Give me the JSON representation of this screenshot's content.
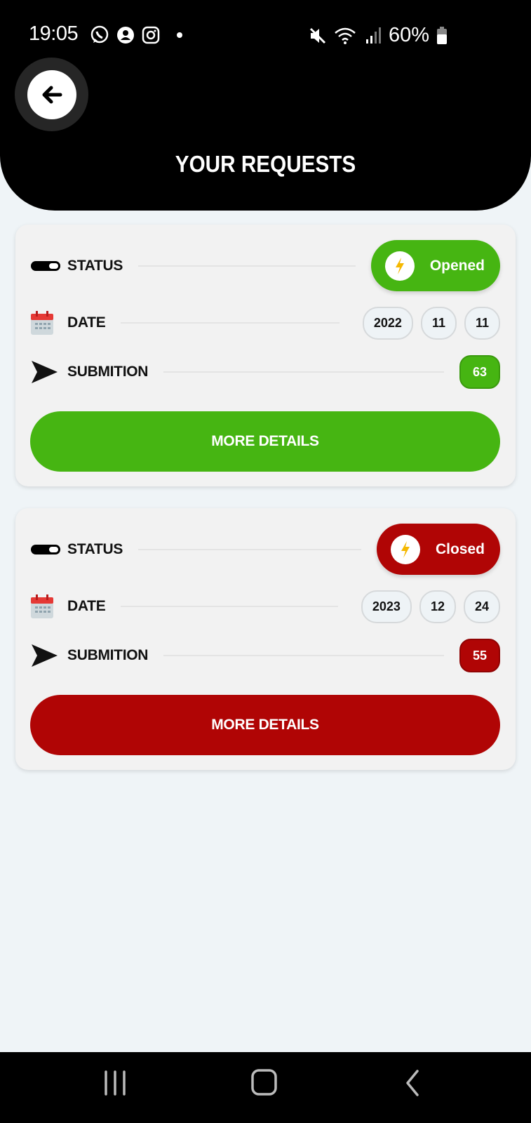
{
  "status_bar": {
    "time": "19:05",
    "battery": "60%",
    "icons": [
      "whatsapp-icon",
      "account-icon",
      "instagram-icon",
      "dot-icon",
      "mute-icon",
      "wifi-icon",
      "signal-icon",
      "battery-icon"
    ]
  },
  "header": {
    "title": "YOUR REQUESTS",
    "back_icon": "arrow-left-icon"
  },
  "labels": {
    "status": "STATUS",
    "date": "DATE",
    "submition": "SUBMITION",
    "more_details": "MORE DETAILS"
  },
  "requests": [
    {
      "status": "Opened",
      "color": "#46b512",
      "date": {
        "year": "2022",
        "month": "11",
        "day": "11"
      },
      "submition": "63"
    },
    {
      "status": "Closed",
      "color": "#b00505",
      "date": {
        "year": "2023",
        "month": "12",
        "day": "24"
      },
      "submition": "55"
    }
  ],
  "nav": {
    "icons": [
      "recent-apps-icon",
      "home-icon",
      "back-icon"
    ]
  }
}
